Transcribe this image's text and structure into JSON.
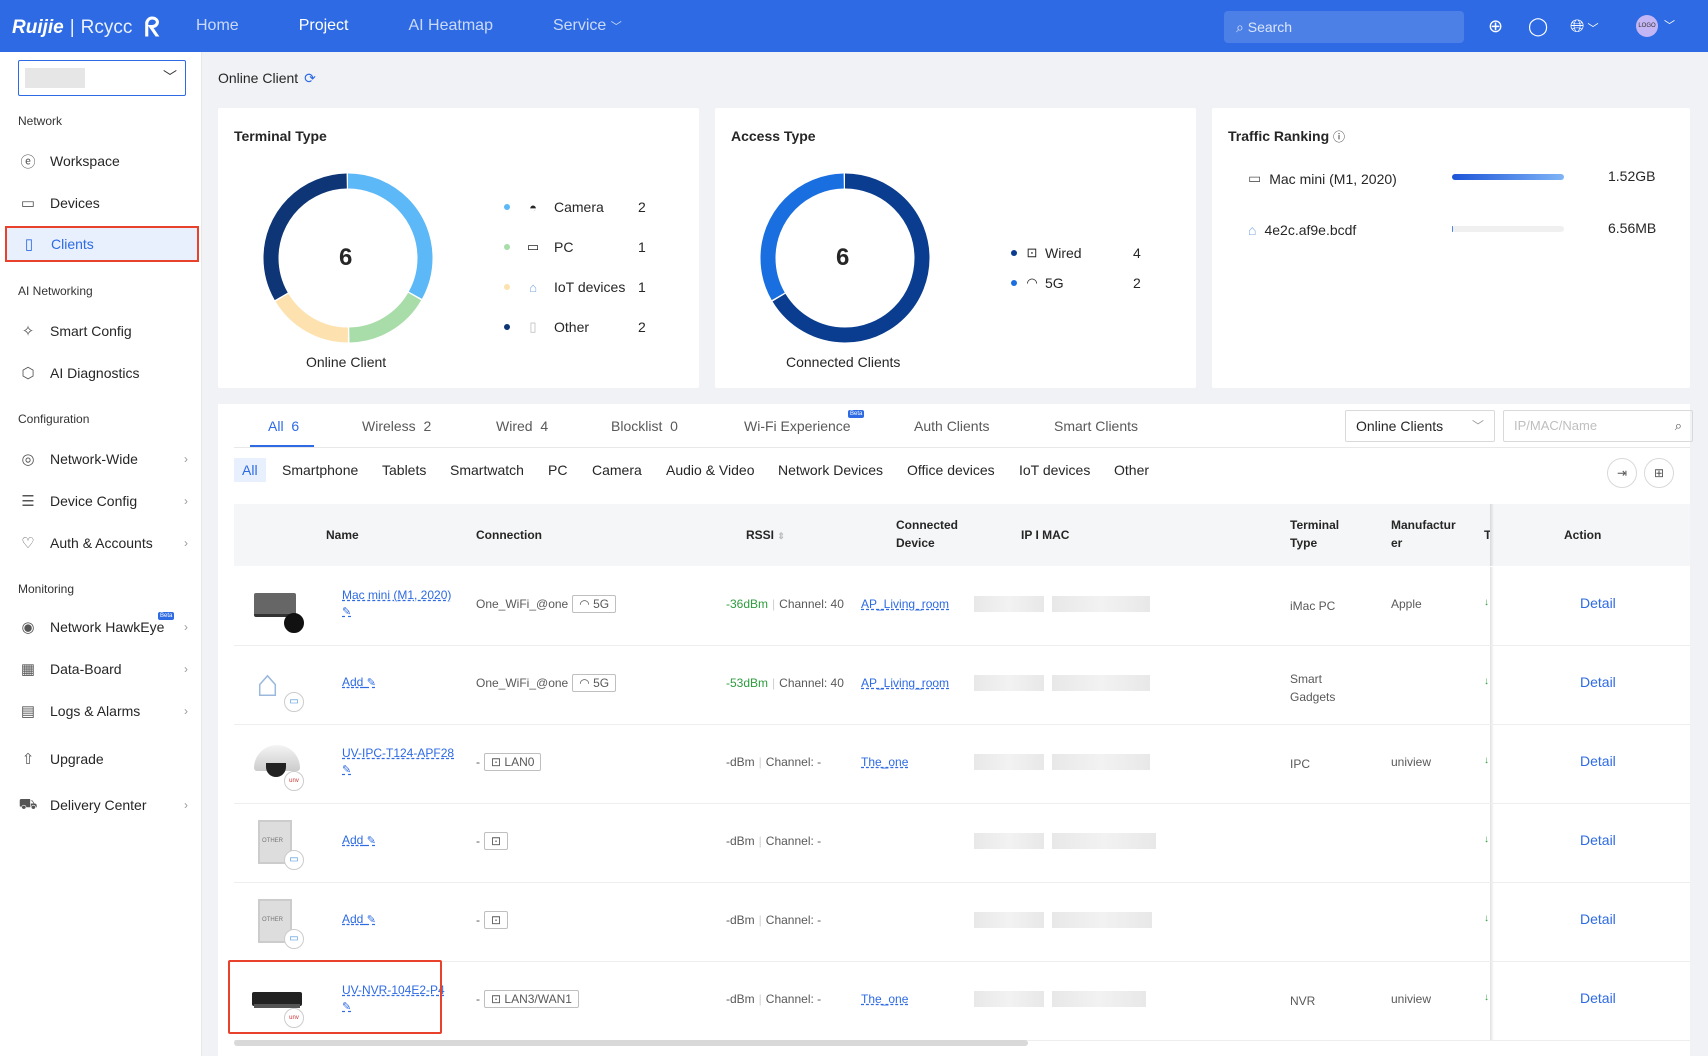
{
  "topbar": {
    "logo_brand": "Ruijie",
    "logo_sep": "|",
    "logo_product": "Rcycc",
    "nav": [
      "Home",
      "Project",
      "AI Heatmap",
      "Service"
    ],
    "active_nav": "Project",
    "search_placeholder": "Search",
    "avatar_text": "LOGO"
  },
  "sidebar": {
    "groups": {
      "network": "Network",
      "ai": "AI Networking",
      "config": "Configuration",
      "monitoring": "Monitoring"
    },
    "items": [
      {
        "label": "Workspace",
        "icon": "workspace-icon"
      },
      {
        "label": "Devices",
        "icon": "devices-icon"
      },
      {
        "label": "Clients",
        "icon": "clients-icon"
      },
      {
        "label": "Smart Config",
        "icon": "smart-config-icon"
      },
      {
        "label": "AI Diagnostics",
        "icon": "ai-diagnostics-icon"
      },
      {
        "label": "Network-Wide",
        "icon": "network-wide-icon"
      },
      {
        "label": "Device Config",
        "icon": "device-config-icon"
      },
      {
        "label": "Auth & Accounts",
        "icon": "auth-icon"
      },
      {
        "label": "Network HawkEye",
        "icon": "hawkeye-icon",
        "badge": "Beta"
      },
      {
        "label": "Data-Board",
        "icon": "data-board-icon"
      },
      {
        "label": "Logs & Alarms",
        "icon": "logs-icon"
      },
      {
        "label": "Upgrade",
        "icon": "upgrade-icon"
      },
      {
        "label": "Delivery Center",
        "icon": "delivery-icon"
      }
    ],
    "active": "Clients"
  },
  "breadcrumb": {
    "title": "Online Client"
  },
  "terminal_type": {
    "title": "Terminal Type",
    "total": "6",
    "caption": "Online Client",
    "legend": [
      {
        "label": "Camera",
        "value": "2",
        "color": "#5cb8f7"
      },
      {
        "label": "PC",
        "value": "1",
        "color": "#a8dca8"
      },
      {
        "label": "IoT devices",
        "value": "1",
        "color": "#fde2b0"
      },
      {
        "label": "Other",
        "value": "2",
        "color": "#0e3576"
      }
    ]
  },
  "access_type": {
    "title": "Access Type",
    "total": "6",
    "caption": "Connected Clients",
    "legend": [
      {
        "label": "Wired",
        "value": "4",
        "color": "#0a3d8f"
      },
      {
        "label": "5G",
        "value": "2",
        "color": "#1a6fe0"
      }
    ]
  },
  "traffic": {
    "title": "Traffic Ranking",
    "rows": [
      {
        "name": "Mac mini (M1, 2020)",
        "value": "1.52GB",
        "fraction": 1.0
      },
      {
        "name": "4e2c.af9e.bcdf",
        "value": "6.56MB",
        "fraction": 0.005
      }
    ]
  },
  "tabs": [
    {
      "label": "All",
      "count": "6"
    },
    {
      "label": "Wireless",
      "count": "2"
    },
    {
      "label": "Wired",
      "count": "4"
    },
    {
      "label": "Blocklist",
      "count": "0"
    },
    {
      "label": "Wi-Fi Experience",
      "count": "",
      "badge": "Beta"
    },
    {
      "label": "Auth Clients",
      "count": ""
    },
    {
      "label": "Smart Clients",
      "count": ""
    }
  ],
  "filter": {
    "select_value": "Online Clients",
    "search_placeholder": "IP/MAC/Name"
  },
  "categories": [
    "All",
    "Smartphone",
    "Tablets",
    "Smartwatch",
    "PC",
    "Camera",
    "Audio & Video",
    "Network Devices",
    "Office devices",
    "IoT devices",
    "Other"
  ],
  "columns": {
    "name": "Name",
    "connection": "Connection",
    "rssi": "RSSI",
    "connected_device_1": "Connected",
    "connected_device_2": "Device",
    "ip_mac": "IP I MAC",
    "terminal_type_1": "Terminal",
    "terminal_type_2": "Type",
    "manufacturer_1": "Manufactur",
    "manufacturer_2": "er",
    "col_t": "T",
    "action": "Action"
  },
  "rows": [
    {
      "name": "Mac mini (M1, 2020)",
      "ssid": "One_WiFi_@one",
      "conn_tag": "5G",
      "conn_icon": "wifi-icon",
      "rssi": "-36dBm",
      "channel": "Channel: 40",
      "rssi_good": true,
      "connected": "AP_Living_room",
      "terminal": "iMac PC",
      "manufacturer": "Apple",
      "action": "Detail",
      "device_icon": "mac-mini-icon"
    },
    {
      "name": "Add",
      "ssid": "One_WiFi_@one",
      "conn_tag": "5G",
      "conn_icon": "wifi-icon",
      "rssi": "-53dBm",
      "channel": "Channel: 40",
      "rssi_good": true,
      "connected": "AP_Living_room",
      "terminal": "Smart Gadgets",
      "manufacturer": "",
      "action": "Detail",
      "device_icon": "iot-icon"
    },
    {
      "name": "UV-IPC-T124-APF28",
      "ssid": "-",
      "conn_tag": "LAN0",
      "conn_icon": "ethernet-icon",
      "rssi": "-dBm",
      "channel": "Channel: -",
      "rssi_good": false,
      "connected": "The_one",
      "terminal": "IPC",
      "manufacturer": "uniview",
      "action": "Detail",
      "device_icon": "camera-icon"
    },
    {
      "name": "Add",
      "ssid": "-",
      "conn_tag": "",
      "conn_icon": "ethernet-icon",
      "rssi": "-dBm",
      "channel": "Channel: -",
      "rssi_good": false,
      "connected": "",
      "terminal": "",
      "manufacturer": "",
      "action": "Detail",
      "device_icon": "other-icon",
      "device_label": "OTHER"
    },
    {
      "name": "Add",
      "ssid": "-",
      "conn_tag": "",
      "conn_icon": "ethernet-icon",
      "rssi": "-dBm",
      "channel": "Channel: -",
      "rssi_good": false,
      "connected": "",
      "terminal": "",
      "manufacturer": "",
      "action": "Detail",
      "device_icon": "other-icon",
      "device_label": "OTHER"
    },
    {
      "name": "UV-NVR-104E2-P4",
      "ssid": "-",
      "conn_tag": "LAN3/WAN1",
      "conn_icon": "ethernet-icon",
      "rssi": "-dBm",
      "channel": "Channel: -",
      "rssi_good": false,
      "connected": "The_one",
      "terminal": "NVR",
      "manufacturer": "uniview",
      "action": "Detail",
      "device_icon": "nvr-icon"
    }
  ]
}
